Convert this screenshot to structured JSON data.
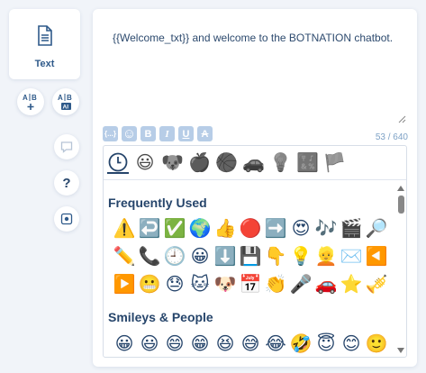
{
  "left_panel": {
    "text_block": {
      "label": "Text",
      "icon": "document-icon"
    },
    "buttons": [
      {
        "name": "add-variable-button",
        "label": "A|B"
      },
      {
        "name": "ai-variable-button",
        "label": "A|B"
      }
    ],
    "tools": [
      "comment-icon",
      "help-icon",
      "settings-icon"
    ],
    "help_label": "?"
  },
  "editor": {
    "message": "{{Welcome_txt}} and welcome to the BOTNATION chatbot.",
    "counter": "53 / 640",
    "format_buttons": [
      "{...}",
      "☺",
      "B",
      "I",
      "U",
      "A"
    ]
  },
  "emoji_picker": {
    "categories": [
      "clock-icon",
      "smiley-icon",
      "dog-icon",
      "apple-icon",
      "basketball-icon",
      "car-icon",
      "bulb-icon",
      "symbols-icon",
      "flag-icon"
    ],
    "sections": [
      {
        "title": "Frequently Used",
        "emojis": [
          "⚠️",
          "↩️",
          "✅",
          "🌍",
          "👍",
          "🔴",
          "➡️",
          "😍",
          "🎶",
          "🎬",
          "🔎",
          "✏️",
          "📞",
          "🕘",
          "😀",
          "⬇️",
          "💾",
          "👇",
          "💡",
          "👱",
          "✉️",
          "◀️",
          "▶️",
          "😬",
          "😓",
          "🐱",
          "🐶",
          "📅",
          "👏",
          "🎤",
          "🚗",
          "⭐",
          "🎺"
        ]
      },
      {
        "title": "Smileys & People",
        "emojis": [
          "😀",
          "😃",
          "😄",
          "😁",
          "😆",
          "😅",
          "😂",
          "🤣",
          "😇",
          "😊",
          "🙂"
        ]
      }
    ]
  }
}
